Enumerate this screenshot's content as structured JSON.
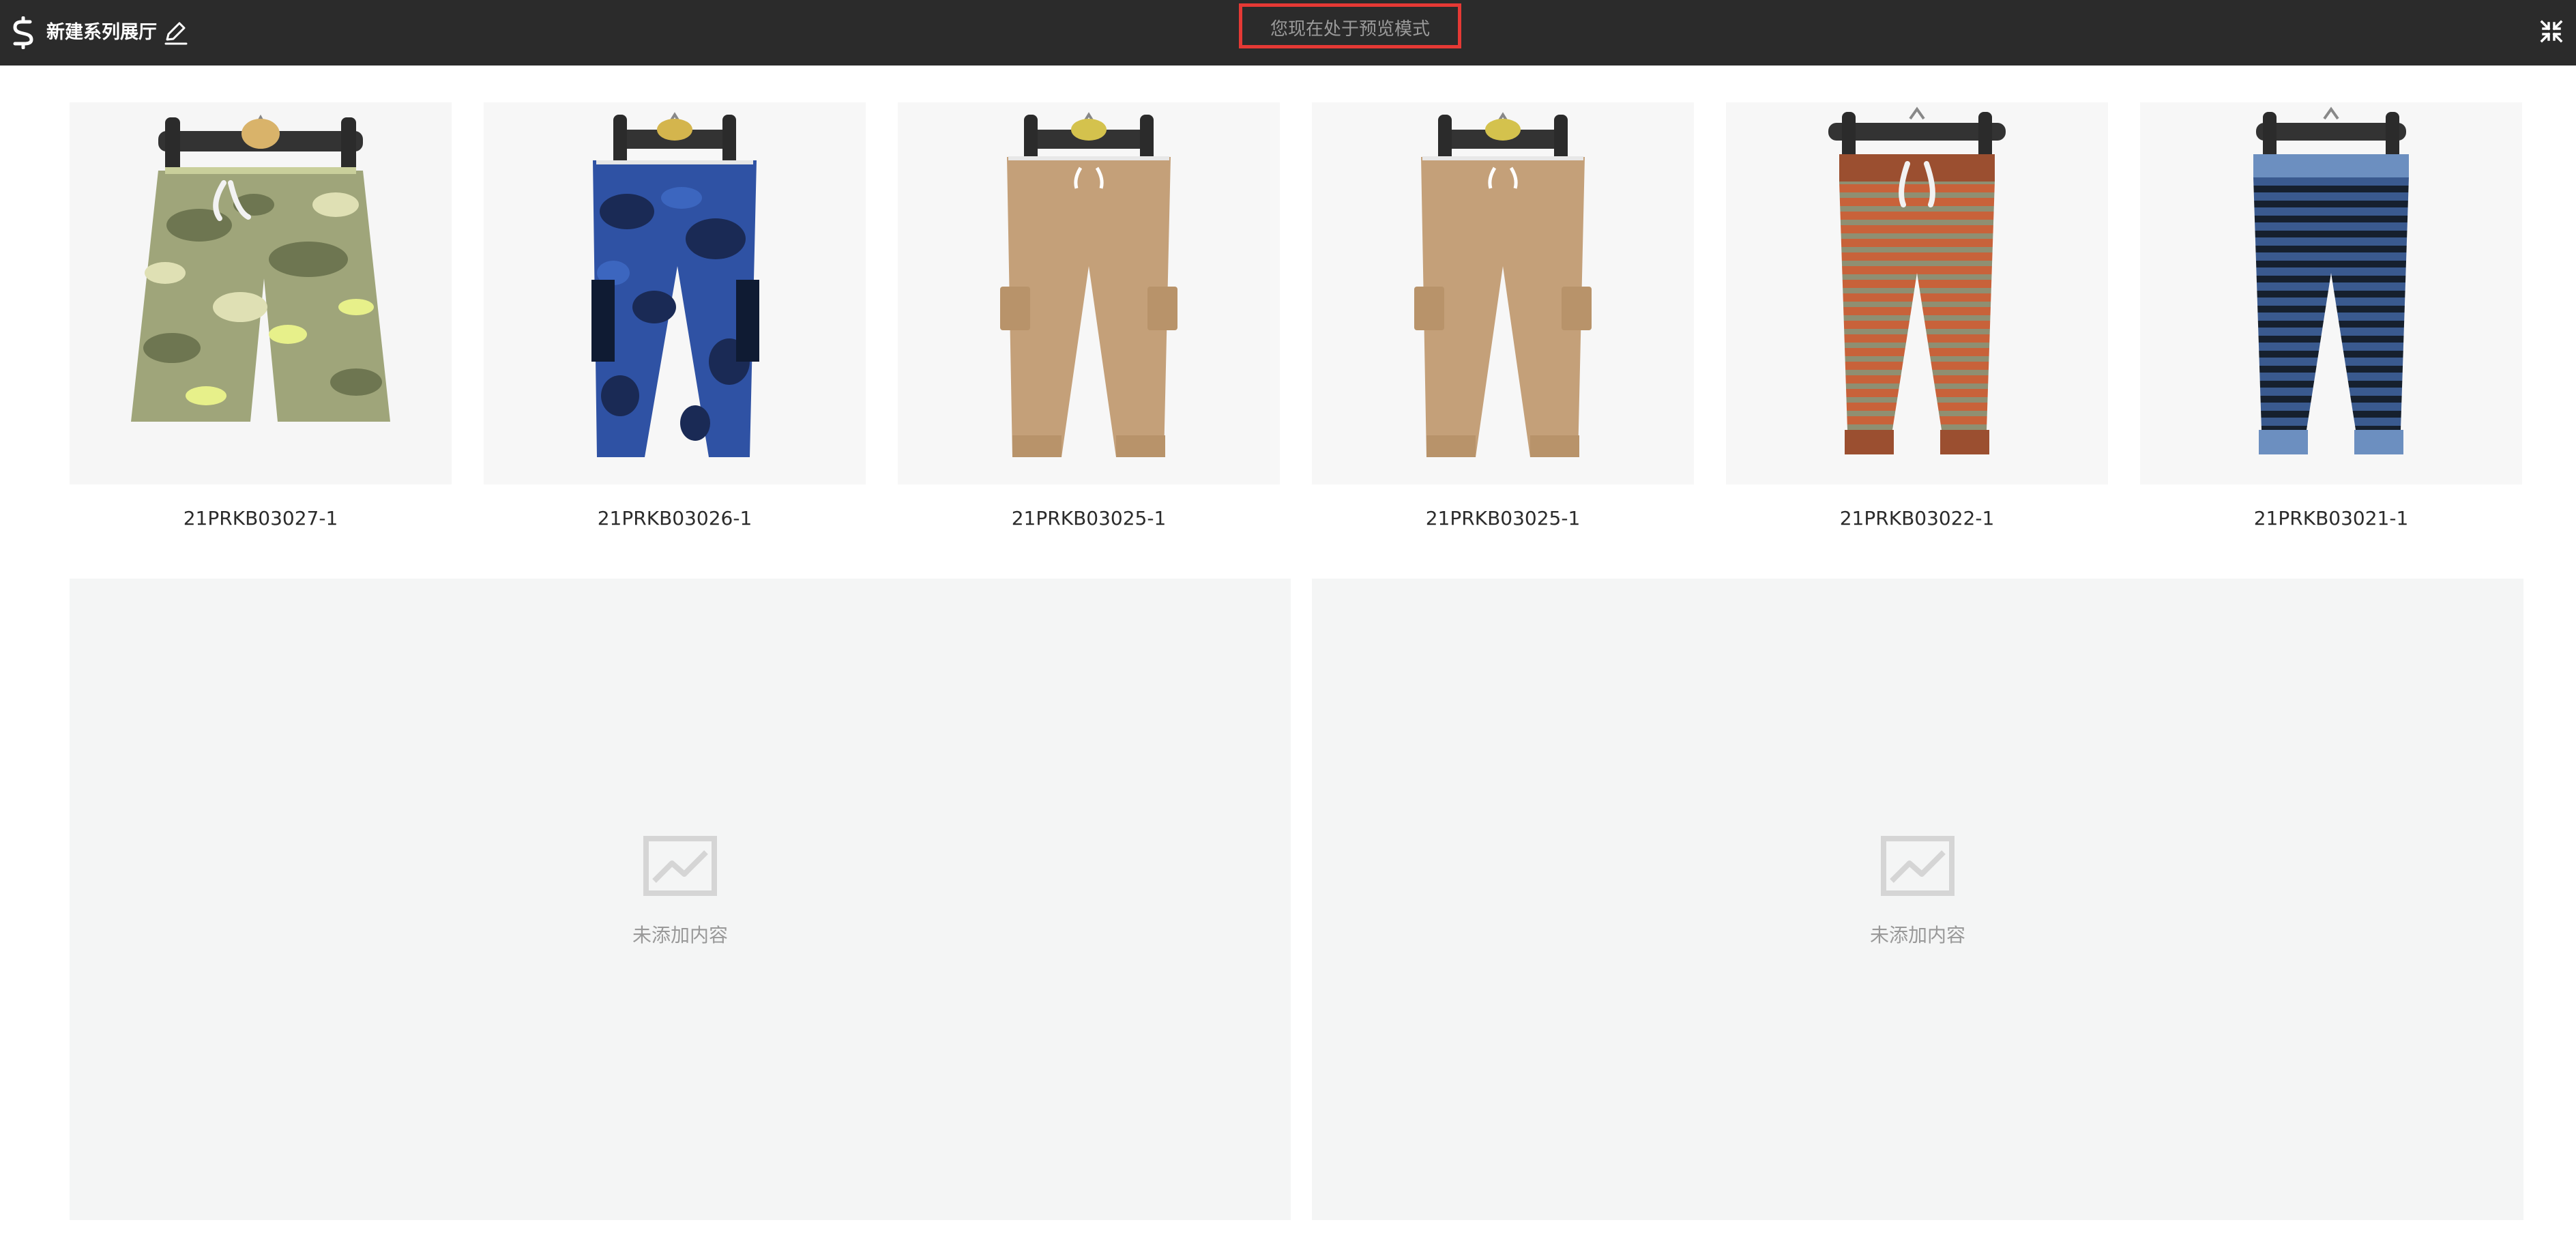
{
  "header": {
    "title": "新建系列展厅",
    "preview_notice": "您现在处于预览模式",
    "icons": [
      "brand-logo-icon",
      "edit-icon",
      "collapse-icon"
    ]
  },
  "products": [
    {
      "sku": "21PRKB03027-1",
      "garment": "shorts",
      "pattern": "camo",
      "colors": [
        "#9fa57a",
        "#6e7651",
        "#dfe0b4",
        "#e7f08a"
      ]
    },
    {
      "sku": "21PRKB03026-1",
      "garment": "cargo-pants",
      "pattern": "camo",
      "colors": [
        "#2f52a4",
        "#1a2a55",
        "#0f1b33",
        "#3c66bf"
      ]
    },
    {
      "sku": "21PRKB03025-1",
      "garment": "cargo-pants",
      "pattern": "solid",
      "colors": [
        "#c4a079",
        "#b8936a"
      ]
    },
    {
      "sku": "21PRKB03025-1",
      "garment": "cargo-pants",
      "pattern": "solid",
      "colors": [
        "#c4a079",
        "#b8936a"
      ]
    },
    {
      "sku": "21PRKB03022-1",
      "garment": "jogger",
      "pattern": "stripe",
      "colors": [
        "#c8623a",
        "#8f8f72",
        "#9b4f30"
      ]
    },
    {
      "sku": "21PRKB03021-1",
      "garment": "jogger",
      "pattern": "stripe",
      "colors": [
        "#3a5a8f",
        "#16202e",
        "#6c8fc0"
      ]
    }
  ],
  "placeholders": [
    {
      "label": "未添加内容"
    },
    {
      "label": "未添加内容"
    }
  ],
  "theme": {
    "topbar": "#2b2b2b",
    "highlight": "#e53935",
    "placeholder_bg": "#f4f5f5"
  }
}
